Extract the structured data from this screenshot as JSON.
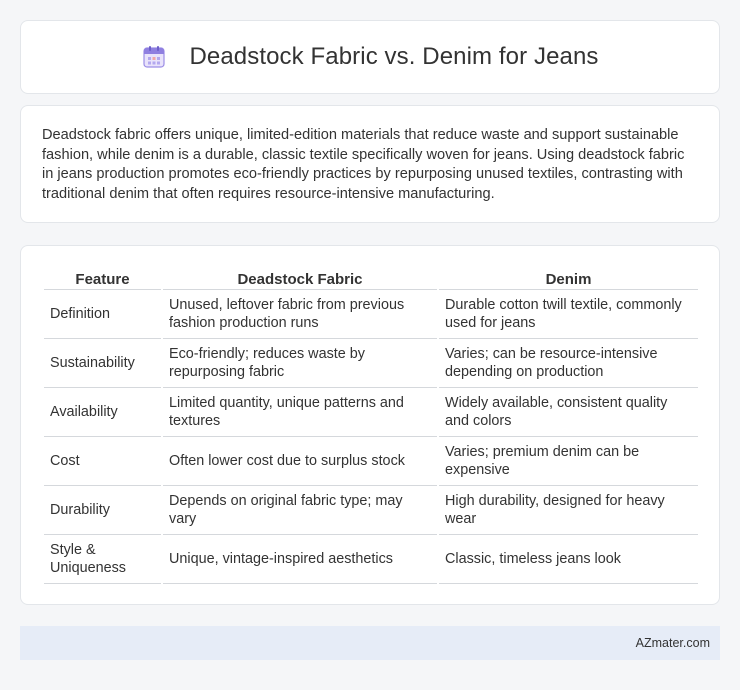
{
  "title": "Deadstock Fabric vs. Denim for Jeans",
  "icon": "calendar-icon",
  "intro": "Deadstock fabric offers unique, limited-edition materials that reduce waste and support sustainable fashion, while denim is a durable, classic textile specifically woven for jeans. Using deadstock fabric in jeans production promotes eco-friendly practices by repurposing unused textiles, contrasting with traditional denim that often requires resource-intensive manufacturing.",
  "table": {
    "headers": [
      "Feature",
      "Deadstock Fabric",
      "Denim"
    ],
    "rows": [
      [
        "Definition",
        "Unused, leftover fabric from previous fashion production runs",
        "Durable cotton twill textile, commonly used for jeans"
      ],
      [
        "Sustainability",
        "Eco-friendly; reduces waste by repurposing fabric",
        "Varies; can be resource-intensive depending on production"
      ],
      [
        "Availability",
        "Limited quantity, unique patterns and textures",
        "Widely available, consistent quality and colors"
      ],
      [
        "Cost",
        "Often lower cost due to surplus stock",
        "Varies; premium denim can be expensive"
      ],
      [
        "Durability",
        "Depends on original fabric type; may vary",
        "High durability, designed for heavy wear"
      ],
      [
        "Style & Uniqueness",
        "Unique, vintage-inspired aesthetics",
        "Classic, timeless jeans look"
      ]
    ]
  },
  "footer": "AZmater.com"
}
